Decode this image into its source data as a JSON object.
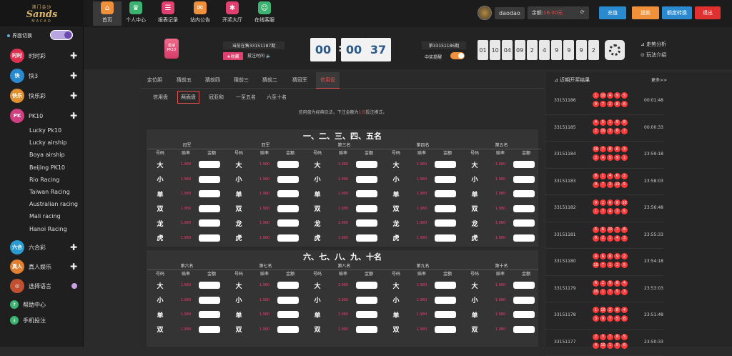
{
  "logo": {
    "line1": "澳门金沙",
    "line2": "Sands",
    "line3": "MACAO"
  },
  "nav": [
    {
      "label": "首页",
      "icon": "home-icon",
      "color": "#f0903a",
      "glyph": "⌂"
    },
    {
      "label": "个人中心",
      "icon": "crown-icon",
      "color": "#3cb371",
      "glyph": "♛"
    },
    {
      "label": "报表记录",
      "icon": "report-icon",
      "color": "#e04070",
      "glyph": "☰"
    },
    {
      "label": "站内公告",
      "icon": "mail-icon",
      "color": "#f0903a",
      "glyph": "✉"
    },
    {
      "label": "开奖大厅",
      "icon": "lottery-icon",
      "color": "#e04070",
      "glyph": "✱"
    },
    {
      "label": "在线客服",
      "icon": "service-icon",
      "color": "#3cb371",
      "glyph": "☺"
    }
  ],
  "user": {
    "name": "daodao",
    "balance_label": "余额:",
    "balance": "16.00元"
  },
  "buttons": {
    "recharge": "充值",
    "withdraw": "提款",
    "transfer": "额度转换",
    "logout": "退出"
  },
  "sidebar": {
    "switch_label": "界面切换",
    "categories": [
      {
        "label": "时时彩",
        "icon": "ssc-icon",
        "color": "#e03050",
        "abbr": "时时"
      },
      {
        "label": "快3",
        "icon": "k3-icon",
        "color": "#2a8ad0",
        "abbr": "快"
      },
      {
        "label": "快乐彩",
        "icon": "klc-icon",
        "color": "#e09030",
        "abbr": "快乐"
      },
      {
        "label": "PK10",
        "icon": "pk10-icon",
        "color": "#d04080",
        "abbr": "PK"
      }
    ],
    "pk10_items": [
      "Lucky Pk10",
      "Lucky airship",
      "Boya airship",
      "Beijing PK10",
      "Rio Racing",
      "Taiwan Racing",
      "Australian racing",
      "Mali racing",
      "Hanoi Racing"
    ],
    "more": [
      {
        "label": "六合彩",
        "icon": "lhc-icon",
        "color": "#2a9ad0",
        "abbr": "六合"
      },
      {
        "label": "真人娱乐",
        "icon": "live-icon",
        "color": "#e08030",
        "abbr": "真人"
      },
      {
        "label": "选择语言",
        "icon": "globe-icon",
        "color": "#c05030",
        "abbr": "◎"
      }
    ],
    "bottom": [
      {
        "label": "帮助中心",
        "icon": "help-icon"
      },
      {
        "label": "手机投注",
        "icon": "mobile-icon"
      }
    ]
  },
  "game": {
    "logo_label": "极速PK10",
    "current_issue": "当前在售33151187期",
    "fav": "★收藏",
    "bet_time": "投注时间",
    "countdown": [
      "00",
      "00",
      "37"
    ],
    "result_issue": "第33151186期",
    "remind": "中奖提醒",
    "numbers": [
      "01",
      "10",
      "04",
      "09",
      "2",
      "4",
      "9",
      "9",
      "9",
      "2"
    ],
    "trend": "走势分析",
    "rules": "玩法介绍"
  },
  "tabs": [
    "定位胆",
    "猜前五",
    "猜前四",
    "猜前三",
    "猜前二",
    "猜冠军",
    "信用盘"
  ],
  "subtabs": [
    "信用盘",
    "两面盘",
    "冠亚和",
    "一至五名",
    "六至十名"
  ],
  "notice": {
    "pre": "信用盘为经典玩法，下注金额为",
    "red": "1元",
    "post": "投注模式。"
  },
  "section1": {
    "title": "一、二、三、四、五名",
    "cols": [
      "冠军",
      "亚军",
      "第三名",
      "第四名",
      "第五名"
    ]
  },
  "section2": {
    "title": "六、七、八、九、十名",
    "cols": [
      "第六名",
      "第七名",
      "第八名",
      "第九名",
      "第十名"
    ]
  },
  "header_cells": {
    "code": "号码",
    "odds": "赔率",
    "amount": "金额"
  },
  "bet_keys": [
    "大",
    "小",
    "单",
    "双",
    "龙",
    "虎"
  ],
  "odds": "1.980",
  "recent": {
    "title": "近期开奖结果",
    "more": "更多>>",
    "rows": [
      {
        "issue": "33151186",
        "time": "00:01:48",
        "r1": [
          "1",
          "10",
          "4",
          "9",
          "5"
        ],
        "r2": [
          "9",
          "7",
          "2",
          "8",
          "6"
        ]
      },
      {
        "issue": "33151185",
        "time": "00:00:33",
        "r1": [
          "4",
          "5",
          "1",
          "9",
          "8"
        ],
        "r2": [
          "2",
          "10",
          "3",
          "6",
          "7"
        ]
      },
      {
        "issue": "33151184",
        "time": "23:59:18",
        "r1": [
          "10",
          "7",
          "8",
          "6",
          "3"
        ],
        "r2": [
          "2",
          "4",
          "5",
          "9",
          "1"
        ]
      },
      {
        "issue": "33151183",
        "time": "23:58:03",
        "r1": [
          "8",
          "1",
          "4",
          "6",
          "2"
        ],
        "r2": [
          "9",
          "7",
          "3",
          "10",
          "5"
        ]
      },
      {
        "issue": "33151182",
        "time": "23:56:48",
        "r1": [
          "9",
          "2",
          "6",
          "8",
          "10"
        ],
        "r2": [
          "1",
          "7",
          "4",
          "3",
          "5"
        ]
      },
      {
        "issue": "33151181",
        "time": "23:55:33",
        "r1": [
          "5",
          "6",
          "10",
          "7",
          "8"
        ],
        "r2": [
          "9",
          "2",
          "1",
          "4",
          "3"
        ]
      },
      {
        "issue": "33151180",
        "time": "23:54:18",
        "r1": [
          "4",
          "6",
          "8",
          "9",
          "2"
        ],
        "r2": [
          "10",
          "7",
          "1",
          "3",
          "5"
        ]
      },
      {
        "issue": "33151179",
        "time": "23:53:03",
        "r1": [
          "6",
          "2",
          "9",
          "8",
          "4"
        ],
        "r2": [
          "10",
          "1",
          "7",
          "5",
          "3"
        ]
      },
      {
        "issue": "33151178",
        "time": "23:51:48",
        "r1": [
          "1",
          "10",
          "2",
          "8",
          "4"
        ],
        "r2": [
          "3",
          "9",
          "7",
          "5",
          "6"
        ]
      },
      {
        "issue": "33151177",
        "time": "23:50:33",
        "r1": [
          "2",
          "3",
          "7",
          "8",
          "5"
        ],
        "r2": [
          "4",
          "10",
          "1",
          "9",
          "6"
        ]
      }
    ]
  },
  "colors": {
    "accent": "#e05050",
    "recharge": "#2a8ad0",
    "withdraw": "#f0903a",
    "transfer": "#2a8ad0",
    "logout": "#e03030"
  }
}
